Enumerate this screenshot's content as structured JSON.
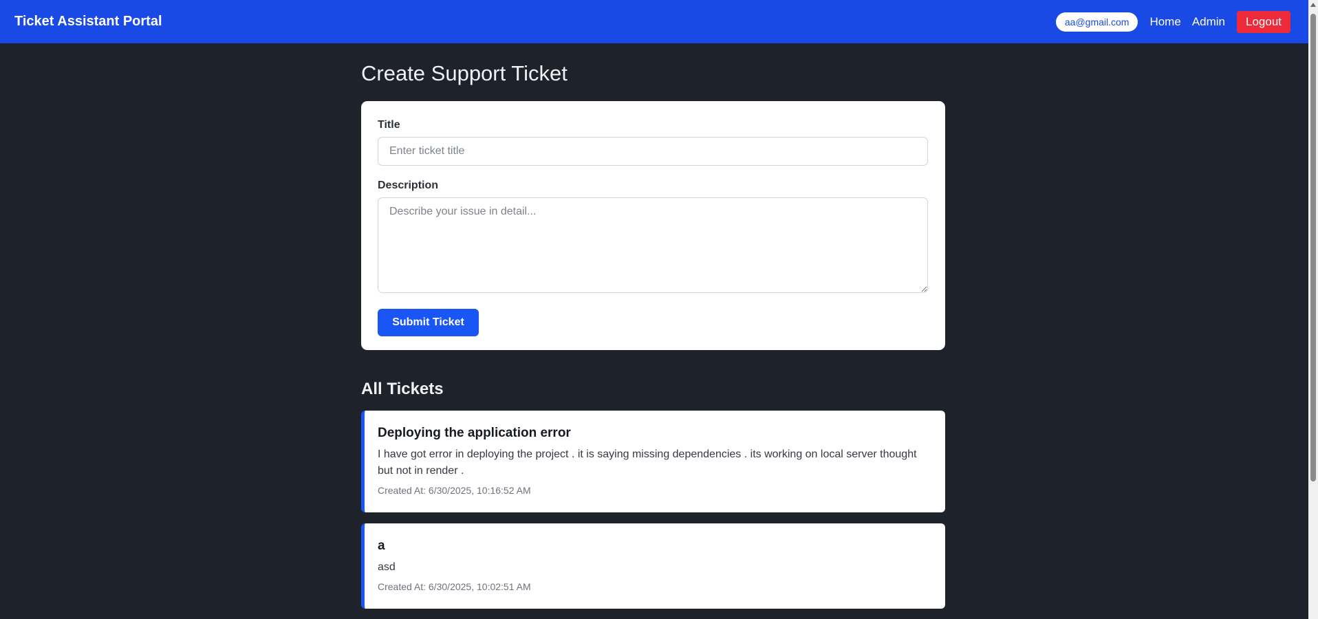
{
  "navbar": {
    "brand": "Ticket Assistant Portal",
    "user_email": "aa@gmail.com",
    "links": {
      "home": "Home",
      "admin": "Admin"
    },
    "logout_label": "Logout"
  },
  "form": {
    "heading": "Create Support Ticket",
    "title_label": "Title",
    "title_placeholder": "Enter ticket title",
    "title_value": "",
    "description_label": "Description",
    "description_placeholder": "Describe your issue in detail...",
    "description_value": "",
    "submit_label": "Submit Ticket"
  },
  "tickets": {
    "heading": "All Tickets",
    "items": [
      {
        "title": "Deploying the application error",
        "description": "I have got error in deploying the project . it is saying missing dependencies . its working on local server thought but not in render .",
        "created_at": "Created At: 6/30/2025, 10:16:52 AM"
      },
      {
        "title": "a",
        "description": "asd",
        "created_at": "Created At: 6/30/2025, 10:02:51 AM"
      }
    ]
  },
  "colors": {
    "navbar_bg": "#1a4ae6",
    "page_bg": "#1e222b",
    "primary_button": "#1a55f5",
    "logout_button": "#ec2a3a",
    "ticket_accent": "#1a55f5"
  }
}
